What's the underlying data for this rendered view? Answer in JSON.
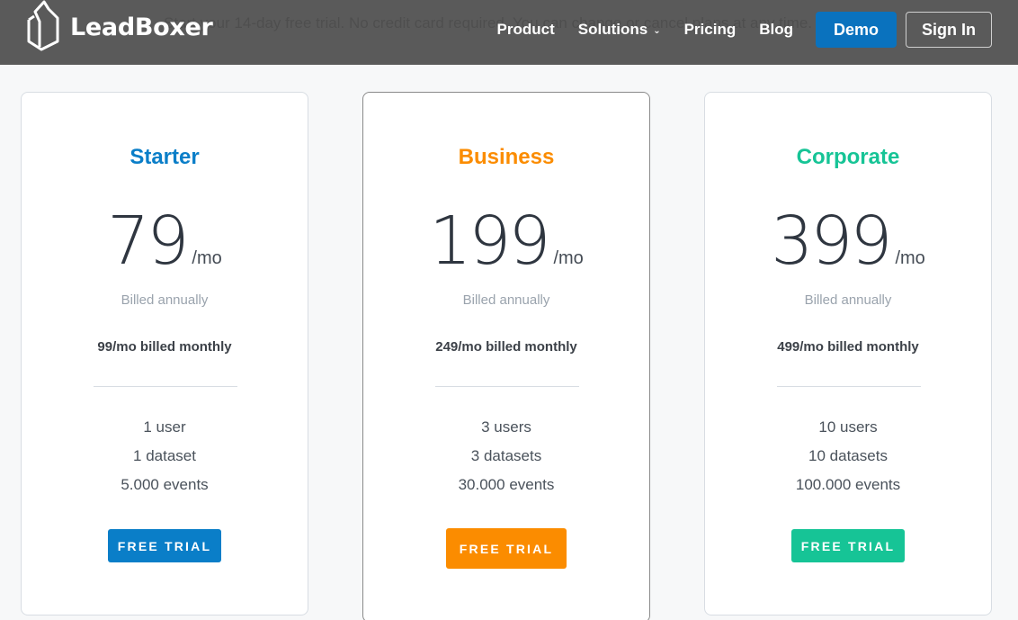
{
  "hero": {
    "subtitle": "Start your 14-day free trial. No credit card required. You can change or cancel plans at any time."
  },
  "nav": {
    "logo_text": "LeadBoxer",
    "links": [
      {
        "label": "Product"
      },
      {
        "label": "Solutions",
        "icon": "chevron-down-icon"
      },
      {
        "label": "Pricing"
      },
      {
        "label": "Blog"
      }
    ],
    "demo_label": "Demo",
    "signin_label": "Sign In",
    "demo_color": "#0a72be"
  },
  "plans": [
    {
      "name": "Starter",
      "color": "#0a7ec8",
      "price": "79",
      "per": "/mo",
      "billed_annual": "Billed annually",
      "billed_monthly": "99/mo billed monthly",
      "features": [
        "1 user",
        "1 dataset",
        "5.000 events"
      ],
      "cta": "FREE TRIAL"
    },
    {
      "name": "Business",
      "color": "#fb8c00",
      "price": "199",
      "per": "/mo",
      "billed_annual": "Billed annually",
      "billed_monthly": "249/mo billed monthly",
      "features": [
        "3 users",
        "3 datasets",
        "30.000 events"
      ],
      "cta": "FREE TRIAL"
    },
    {
      "name": "Corporate",
      "color": "#16c496",
      "price": "399",
      "per": "/mo",
      "billed_annual": "Billed annually",
      "billed_monthly": "499/mo billed monthly",
      "features": [
        "10 users",
        "10 datasets",
        "100.000 events"
      ],
      "cta": "FREE TRIAL"
    }
  ]
}
